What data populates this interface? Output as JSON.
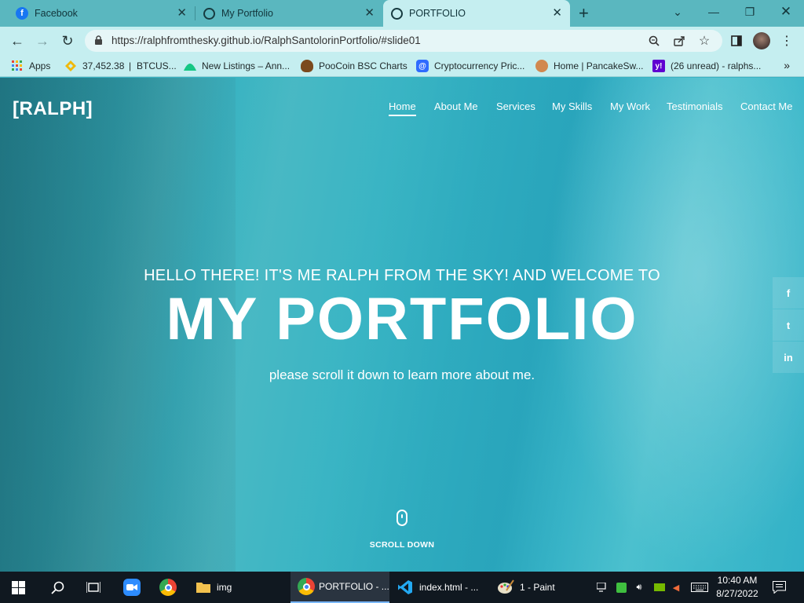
{
  "browser": {
    "tabs": [
      {
        "title": "Facebook",
        "favicon": "facebook-icon"
      },
      {
        "title": "My Portfolio",
        "favicon": "globe-icon"
      },
      {
        "title": "PORTFOLIO",
        "favicon": "globe-icon",
        "active": true
      }
    ],
    "url": "https://ralphfromthesky.github.io/RalphSantolorinPortfolio/#slide01",
    "bookmarks": [
      {
        "label": "Apps",
        "icon": "apps-grid-icon"
      },
      {
        "label": "37,452.38",
        "icon": "binance-icon"
      },
      {
        "label": "BTCUS...",
        "icon": "none"
      },
      {
        "label": "New Listings – Ann...",
        "icon": "coinmarket-icon"
      },
      {
        "label": "PooCoin BSC Charts",
        "icon": "poocoin-icon"
      },
      {
        "label": "Cryptocurrency Pric...",
        "icon": "coingecko-icon"
      },
      {
        "label": "Home | PancakeSw...",
        "icon": "pancake-icon"
      },
      {
        "label": "(26 unread) - ralphs...",
        "icon": "yahoo-icon"
      }
    ]
  },
  "site": {
    "logo": "[RALPH]",
    "nav": [
      "Home",
      "About Me",
      "Services",
      "My Skills",
      "My Work",
      "Testimonials",
      "Contact Me"
    ],
    "hero": {
      "subtitle": "HELLO THERE! IT'S ME RALPH FROM THE SKY! AND WELCOME TO",
      "title": "MY PORTFOLIO",
      "note": "please scroll it down to learn more about me."
    },
    "social": [
      {
        "label": "f",
        "icon": "facebook-icon"
      },
      {
        "label": "t",
        "icon": "twitter-icon"
      },
      {
        "label": "in",
        "icon": "linkedin-icon"
      }
    ],
    "scroll_label": "SCROLL DOWN"
  },
  "taskbar": {
    "items": [
      {
        "label": "",
        "icon": "zoom-icon"
      },
      {
        "label": "",
        "icon": "chrome-icon"
      },
      {
        "label": "img",
        "icon": "folder-icon"
      },
      {
        "label": "PORTFOLIO - ...",
        "icon": "chrome-icon",
        "active": true
      },
      {
        "label": "index.html - ...",
        "icon": "vscode-icon"
      },
      {
        "label": "1 - Paint",
        "icon": "paint-icon"
      }
    ],
    "time": "10:40 AM",
    "date": "8/27/2022"
  },
  "colors": {
    "accent": "#5ab7bf",
    "tab_active": "#c5eef0",
    "overlay": "#28becd",
    "taskbar": "#101820"
  }
}
